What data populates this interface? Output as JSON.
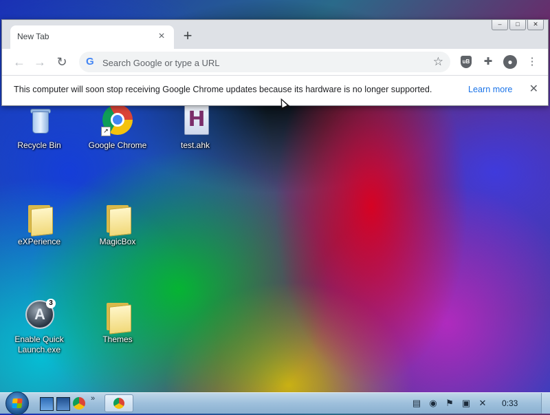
{
  "desktop": {
    "icons": [
      {
        "label": "Recycle Bin"
      },
      {
        "label": "Google Chrome"
      },
      {
        "label": "test.ahk"
      },
      {
        "label": "eXPerience"
      },
      {
        "label": "MagicBox"
      },
      {
        "label": "Enable Quick Launch.exe"
      },
      {
        "label": "Themes"
      }
    ]
  },
  "browser": {
    "tab": {
      "title": "New Tab",
      "close_icon": "×"
    },
    "new_tab_icon": "+",
    "window_buttons": {
      "minimize": "–",
      "maximize": "□",
      "close": "✕"
    },
    "toolbar": {
      "back_icon": "←",
      "forward_icon": "→",
      "reload_icon": "↻",
      "omnibox": {
        "placeholder": "Search Google or type a URL",
        "value": ""
      },
      "star_icon": "☆",
      "ublock_label": "uB",
      "extensions_icon": "✚",
      "profile_icon": "●",
      "menu_icon": "⋮"
    },
    "infobar": {
      "message": "This computer will soon stop receiving Google Chrome updates because its hardware is no longer supported.",
      "link": "Learn more",
      "close_icon": "✕"
    }
  },
  "taskbar": {
    "quick_launch_more": "»",
    "tray": {
      "clock": "0:33"
    }
  },
  "colors": {
    "accent": "#1a73e8",
    "chrome_red": "#db4437",
    "chrome_yellow": "#f4c20d",
    "chrome_green": "#0f9d58",
    "chrome_blue": "#4285f4"
  }
}
